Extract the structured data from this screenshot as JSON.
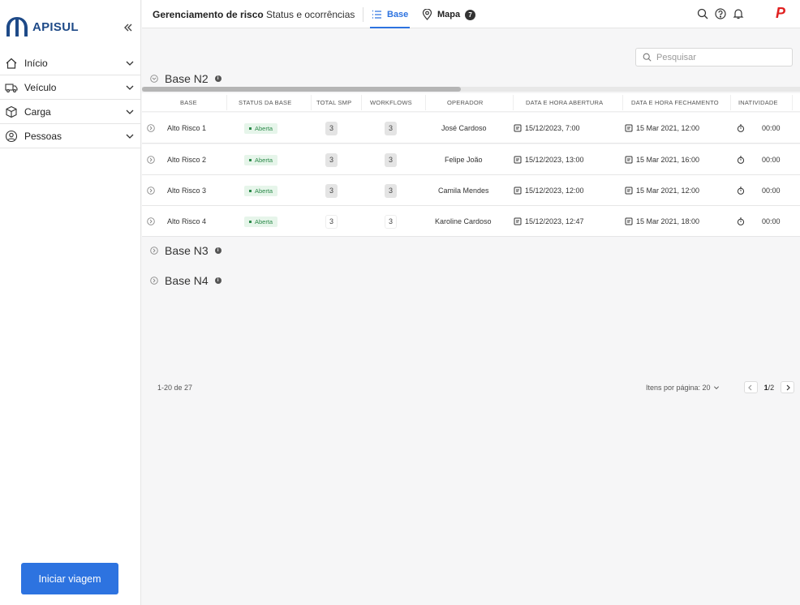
{
  "sidebar": {
    "logo_text": "APISUL",
    "items": [
      {
        "label": "Início"
      },
      {
        "label": "Veículo"
      },
      {
        "label": "Carga"
      },
      {
        "label": "Pessoas"
      }
    ],
    "primary_button": "Iniciar viagem"
  },
  "topbar": {
    "title": "Gerenciamento de risco",
    "tab_status": "Status e ocorrências",
    "tab_base": "Base",
    "tab_mapa": "Mapa",
    "mapa_badge": "7",
    "brand_letter": "P"
  },
  "search": {
    "placeholder": "Pesquisar"
  },
  "groups": [
    {
      "title": "Base N2",
      "expanded": true
    },
    {
      "title": "Base N3",
      "expanded": false
    },
    {
      "title": "Base N4",
      "expanded": false
    }
  ],
  "table": {
    "columns": [
      "BASE",
      "STATUS DA BASE",
      "TOTAL SMP",
      "WORKFLOWS",
      "OPERADOR",
      "DATA E HORA ABERTURA",
      "DATA E HORA FECHAMENTO",
      "INATIVIDADE"
    ],
    "rows": [
      {
        "base": "Alto Risco 1",
        "status": "Aberta",
        "total_smp": "3",
        "workflows": "3",
        "operador": "José Cardoso",
        "abertura": "15/12/2023, 7:00",
        "fechamento": "15 Mar 2021, 12:00",
        "inatividade": "00:00"
      },
      {
        "base": "Alto Risco 2",
        "status": "Aberta",
        "total_smp": "3",
        "workflows": "3",
        "operador": "Felipe João",
        "abertura": "15/12/2023, 13:00",
        "fechamento": "15 Mar 2021, 16:00",
        "inatividade": "00:00"
      },
      {
        "base": "Alto Risco 3",
        "status": "Aberta",
        "total_smp": "3",
        "workflows": "3",
        "operador": "Camila Mendes",
        "abertura": "15/12/2023, 12:00",
        "fechamento": "15 Mar 2021, 12:00",
        "inatividade": "00:00"
      },
      {
        "base": "Alto Risco 4",
        "status": "Aberta",
        "total_smp": "3",
        "workflows": "3",
        "operador": "Karoline Cardoso",
        "abertura": "15/12/2023, 12:47",
        "fechamento": "15 Mar 2021, 18:00",
        "inatividade": "00:00"
      }
    ]
  },
  "pagination": {
    "range_text": "1-20 de 27",
    "items_per_page_label": "Itens por página: 20",
    "current_page": "1",
    "total_pages": "/2"
  },
  "colors": {
    "accent": "#2d73e0",
    "status_green": "#2c8a4a",
    "brand_red": "#e02020",
    "logo_blue": "#1e4a88"
  }
}
